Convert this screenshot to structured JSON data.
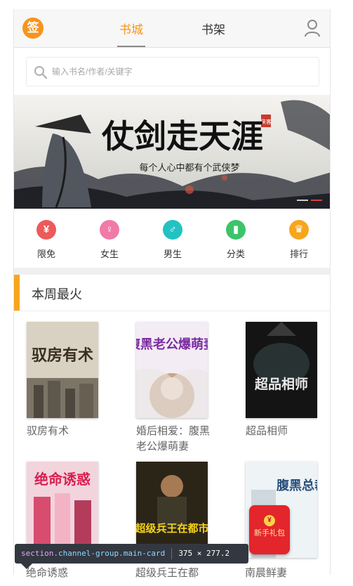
{
  "header": {
    "logo_text": "签",
    "tabs": [
      {
        "label": "书城",
        "active": true
      },
      {
        "label": "书架",
        "active": false
      }
    ],
    "accent_color": "#f7941d"
  },
  "search": {
    "placeholder": "输入书名/作者/关键字"
  },
  "banner": {
    "title_art": "仗剑走天涯",
    "subtitle_art": "每个人心中都有个武侠梦",
    "seal": "侠客",
    "slide_count": 2,
    "active_slide": 2
  },
  "categories": [
    {
      "label": "限免",
      "icon": "yen-icon",
      "glyph": "¥",
      "color": "#ec5a5a"
    },
    {
      "label": "女生",
      "icon": "female-icon",
      "glyph": "♀",
      "color": "#f07aa8"
    },
    {
      "label": "男生",
      "icon": "male-icon",
      "glyph": "♂",
      "color": "#23c2c2"
    },
    {
      "label": "分类",
      "icon": "book-icon",
      "glyph": "▮",
      "color": "#3cc46a"
    },
    {
      "label": "排行",
      "icon": "trophy-icon",
      "glyph": "♛",
      "color": "#f7a51c"
    }
  ],
  "section": {
    "title": "本周最火"
  },
  "books": [
    {
      "title": "驭房有术",
      "cover_text": "驭房有术"
    },
    {
      "title": "婚后相爱：腹黑老公爆萌妻",
      "cover_text": "腹黑老公爆萌妻"
    },
    {
      "title": "超品相师",
      "cover_text": "超品相师"
    },
    {
      "title": "绝命诱惑",
      "cover_text": "绝命诱惑"
    },
    {
      "title": "超级兵王在都市",
      "cover_text": "超级兵王在都市"
    },
    {
      "title": "南晨鲜妻",
      "cover_text": "腹黑总裁"
    }
  ],
  "gift": {
    "text": "新手礼包",
    "coin": "¥"
  },
  "devtools_tooltip": {
    "tag": "section",
    "classes": ".channel-group.main-card",
    "size": "375 × 277.2"
  },
  "partially_visible_titles": [
    "绝命诱惑",
    "超级兵王在都",
    "南晨鲜妻"
  ]
}
